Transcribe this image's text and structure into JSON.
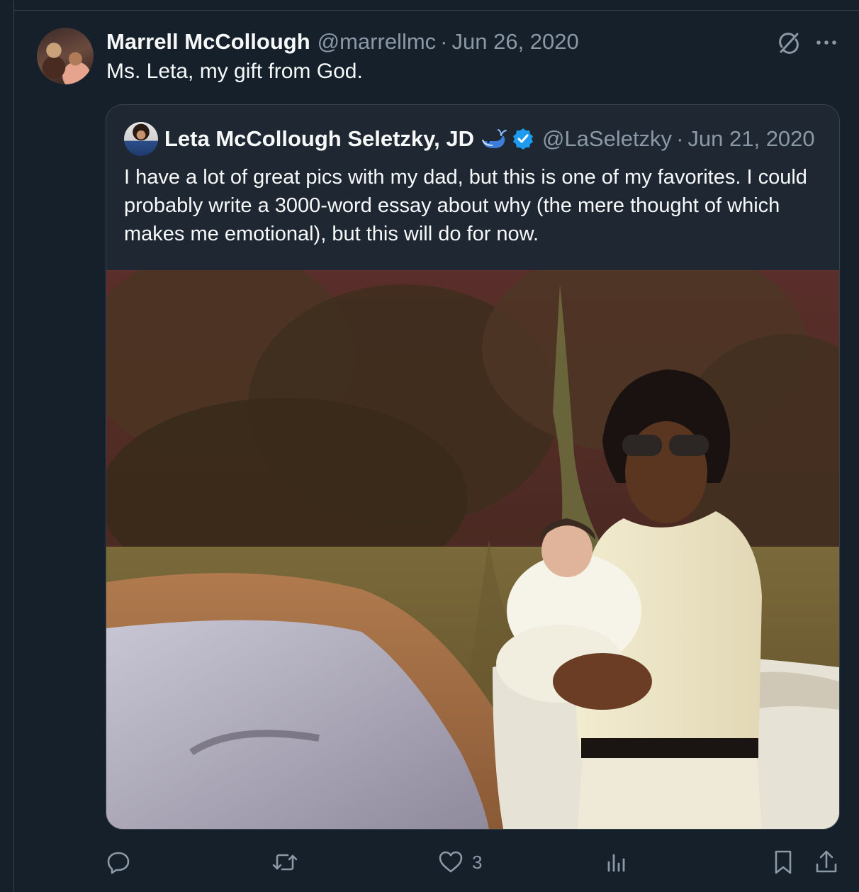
{
  "post": {
    "author_name": "Marrell McCollough",
    "author_handle": "@marrellmc",
    "separator": "·",
    "date": "Jun 26, 2020",
    "text": "Ms. Leta, my gift from God."
  },
  "quoted_post": {
    "author_name": "Leta McCollough Seletzky, JD",
    "author_handle": "@LaSeletzky",
    "separator": "·",
    "date": "Jun 21, 2020",
    "text": "I have a lot of great pics with my dad, but this is one of my favorites. I could probably write a 3000-word essay about why (the mere thought of which makes me emotional), but this will do for now."
  },
  "actions": {
    "reply_icon": "reply-icon",
    "repost_icon": "repost-icon",
    "like_icon": "heart-icon",
    "like_count": "3",
    "views_icon": "views-icon",
    "bookmark_icon": "bookmark-icon",
    "share_icon": "share-icon"
  },
  "colors": {
    "background": "#15202b",
    "border": "#38444d",
    "secondary_text": "#8b98a5",
    "verified_blue": "#1d9bf0"
  }
}
